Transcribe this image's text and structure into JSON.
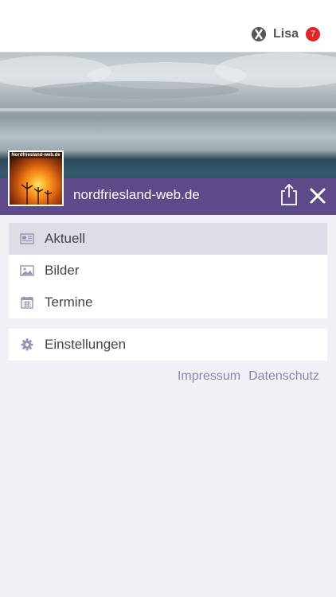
{
  "user": {
    "name": "Lisa",
    "badge_count": "7",
    "icon": "user-network-icon"
  },
  "hero": {
    "site_title": "nordfriesland-web.de",
    "logo_text": "Nordfriesland-web.de"
  },
  "actions": {
    "share_icon": "share-icon",
    "close_icon": "close-icon"
  },
  "menu": {
    "items": [
      {
        "label": "Aktuell",
        "icon": "newspaper-icon",
        "selected": true
      },
      {
        "label": "Bilder",
        "icon": "image-icon",
        "selected": false
      },
      {
        "label": "Termine",
        "icon": "calendar-icon",
        "selected": false
      }
    ],
    "settings": {
      "label": "Einstellungen",
      "icon": "gear-icon"
    }
  },
  "footer": {
    "impressum": "Impressum",
    "datenschutz": "Datenschutz"
  },
  "colors": {
    "accent": "#5c4a89",
    "selected_row": "#dfdce6",
    "badge": "#e4232b",
    "link": "#8f84ad",
    "background": "#f1f0f5"
  }
}
